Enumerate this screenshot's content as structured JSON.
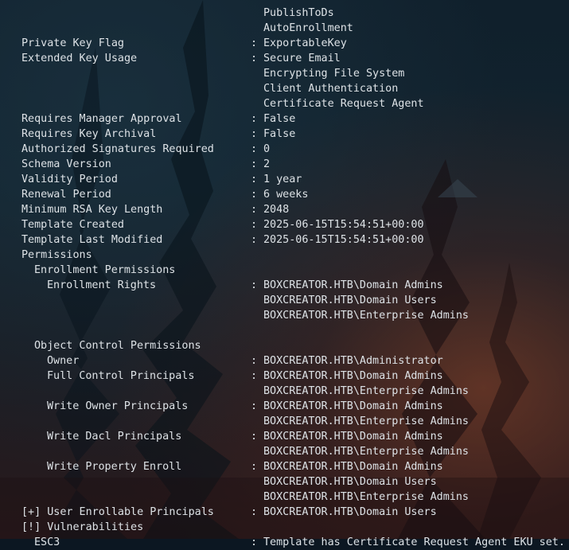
{
  "terminal": {
    "lines": [
      {
        "indent": 0,
        "key": "",
        "sep": false,
        "value": "PublishToDs"
      },
      {
        "indent": 0,
        "key": "",
        "sep": false,
        "value": "AutoEnrollment"
      },
      {
        "indent": 0,
        "key": "Private Key Flag",
        "sep": true,
        "value": "ExportableKey"
      },
      {
        "indent": 0,
        "key": "Extended Key Usage",
        "sep": true,
        "value": "Secure Email"
      },
      {
        "indent": 0,
        "key": "",
        "sep": false,
        "value": "Encrypting File System"
      },
      {
        "indent": 0,
        "key": "",
        "sep": false,
        "value": "Client Authentication"
      },
      {
        "indent": 0,
        "key": "",
        "sep": false,
        "value": "Certificate Request Agent"
      },
      {
        "indent": 0,
        "key": "Requires Manager Approval",
        "sep": true,
        "value": "False"
      },
      {
        "indent": 0,
        "key": "Requires Key Archival",
        "sep": true,
        "value": "False"
      },
      {
        "indent": 0,
        "key": "Authorized Signatures Required",
        "sep": true,
        "value": "0"
      },
      {
        "indent": 0,
        "key": "Schema Version",
        "sep": true,
        "value": "2"
      },
      {
        "indent": 0,
        "key": "Validity Period",
        "sep": true,
        "value": "1 year"
      },
      {
        "indent": 0,
        "key": "Renewal Period",
        "sep": true,
        "value": "6 weeks"
      },
      {
        "indent": 0,
        "key": "Minimum RSA Key Length",
        "sep": true,
        "value": "2048"
      },
      {
        "indent": 0,
        "key": "Template Created",
        "sep": true,
        "value": "2025-06-15T15:54:51+00:00"
      },
      {
        "indent": 0,
        "key": "Template Last Modified",
        "sep": true,
        "value": "2025-06-15T15:54:51+00:00"
      },
      {
        "indent": 0,
        "key": "Permissions",
        "sep": false,
        "value": ""
      },
      {
        "indent": 1,
        "key": "Enrollment Permissions",
        "sep": false,
        "value": ""
      },
      {
        "indent": 2,
        "key": "Enrollment Rights",
        "sep": true,
        "value": "BOXCREATOR.HTB\\Domain Admins"
      },
      {
        "indent": 0,
        "key": "",
        "sep": false,
        "value": "BOXCREATOR.HTB\\Domain Users"
      },
      {
        "indent": 0,
        "key": "",
        "sep": false,
        "value": "BOXCREATOR.HTB\\Enterprise Admins"
      },
      {
        "indent": 0,
        "key": "",
        "sep": false,
        "value": ""
      },
      {
        "indent": 1,
        "key": "Object Control Permissions",
        "sep": false,
        "value": ""
      },
      {
        "indent": 2,
        "key": "Owner",
        "sep": true,
        "value": "BOXCREATOR.HTB\\Administrator"
      },
      {
        "indent": 2,
        "key": "Full Control Principals",
        "sep": true,
        "value": "BOXCREATOR.HTB\\Domain Admins"
      },
      {
        "indent": 0,
        "key": "",
        "sep": false,
        "value": "BOXCREATOR.HTB\\Enterprise Admins"
      },
      {
        "indent": 2,
        "key": "Write Owner Principals",
        "sep": true,
        "value": "BOXCREATOR.HTB\\Domain Admins"
      },
      {
        "indent": 0,
        "key": "",
        "sep": false,
        "value": "BOXCREATOR.HTB\\Enterprise Admins"
      },
      {
        "indent": 2,
        "key": "Write Dacl Principals",
        "sep": true,
        "value": "BOXCREATOR.HTB\\Domain Admins"
      },
      {
        "indent": 0,
        "key": "",
        "sep": false,
        "value": "BOXCREATOR.HTB\\Enterprise Admins"
      },
      {
        "indent": 2,
        "key": "Write Property Enroll",
        "sep": true,
        "value": "BOXCREATOR.HTB\\Domain Admins"
      },
      {
        "indent": 0,
        "key": "",
        "sep": false,
        "value": "BOXCREATOR.HTB\\Domain Users"
      },
      {
        "indent": 0,
        "key": "",
        "sep": false,
        "value": "BOXCREATOR.HTB\\Enterprise Admins"
      },
      {
        "indent": 0,
        "key": "[+] User Enrollable Principals",
        "sep": true,
        "value": "BOXCREATOR.HTB\\Domain Users"
      },
      {
        "indent": 0,
        "key": "[!] Vulnerabilities",
        "sep": false,
        "value": ""
      },
      {
        "indent": 1,
        "key": "ESC3",
        "sep": true,
        "value": "Template has Certificate Request Agent EKU set."
      }
    ]
  }
}
